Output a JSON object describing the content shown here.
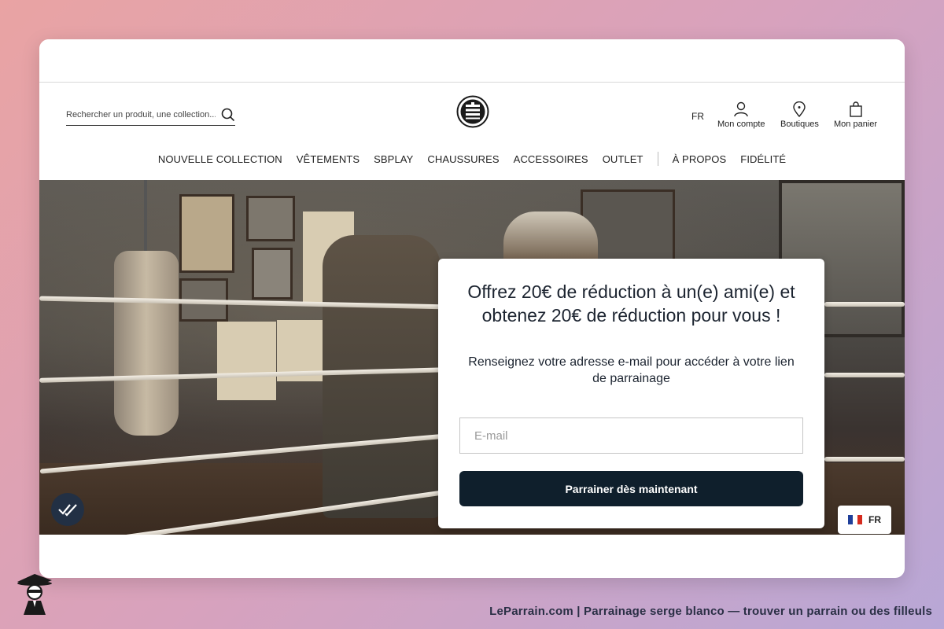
{
  "search": {
    "placeholder": "Rechercher un produit, une collection..."
  },
  "header": {
    "language": "FR",
    "account_label": "Mon compte",
    "stores_label": "Boutiques",
    "cart_label": "Mon panier"
  },
  "nav": {
    "items": [
      "NOUVELLE COLLECTION",
      "VÊTEMENTS",
      "SBPLAY",
      "CHAUSSURES",
      "ACCESSOIRES",
      "OUTLET"
    ],
    "secondary": [
      "À PROPOS",
      "FIDÉLITÉ"
    ]
  },
  "modal": {
    "title": "Offrez 20€ de réduction à un(e) ami(e) et obtenez 20€ de réduction pour vous !",
    "subtitle": "Renseignez votre adresse e-mail pour accéder à votre lien de parrainage",
    "email_placeholder": "E-mail",
    "cta": "Parrainer dès maintenant"
  },
  "language_badge": "FR",
  "footer": {
    "caption": "LeParrain.com | Parrainage serge blanco — trouver un parrain ou des filleuls"
  },
  "colors": {
    "cta_background": "#0f1f2c",
    "badge_background": "#223044",
    "background_gradient_start": "#e9a3a3",
    "background_gradient_end": "#b8a7d6"
  },
  "icons": [
    "search-icon",
    "logo-emblem",
    "user-icon",
    "location-pin-icon",
    "shopping-bag-icon",
    "double-check-icon",
    "french-flag-icon",
    "mascot-logo"
  ]
}
